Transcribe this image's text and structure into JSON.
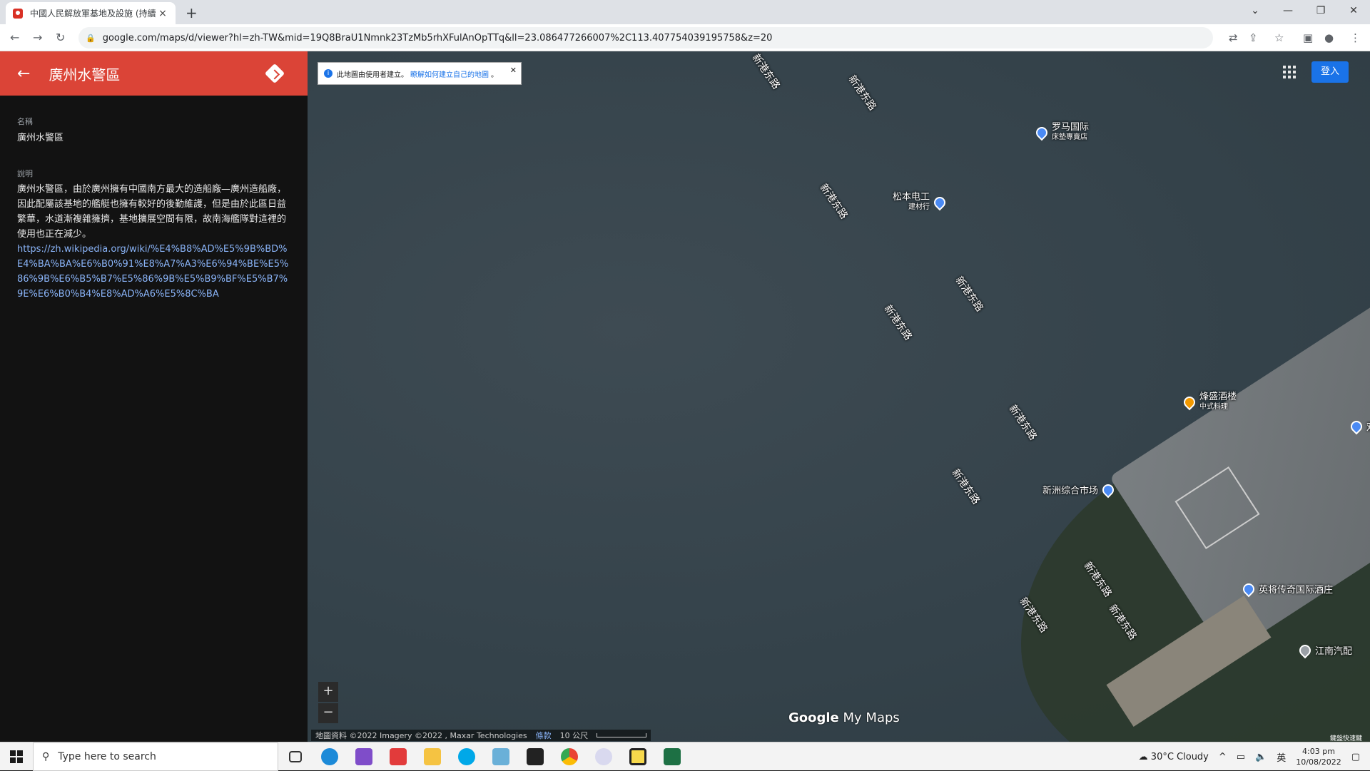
{
  "browser": {
    "tab_title": "中國人民解放軍基地及設施 (持續",
    "tab_close": "×",
    "new_tab": "+",
    "url": "google.com/maps/d/viewer?hl=zh-TW&mid=19Q8BraU1Nmnk23TzMb5rhXFulAnOpTTq&ll=23.086477266007%2C113.407754039195758&z=20"
  },
  "panel": {
    "title": "廣州水警區",
    "name_label": "名稱",
    "name_value": "廣州水警區",
    "desc_label": "說明",
    "description": "廣州水警區，由於廣州擁有中國南方最大的造船廠—廣州造船廠，因此配屬該基地的艦艇也擁有較好的後勤維護，但是由於此區日益繁華，水道漸複雜擁擠，基地擴展空間有限，故南海艦隊對這裡的使用也正在減少。",
    "link": "https://zh.wikipedia.org/wiki/%E4%B8%AD%E5%9B%BD%E4%BA%BA%E6%B0%91%E8%A7%A3%E6%94%BE%E5%86%9B%E6%B5%B7%E5%86%9B%E5%B9%BF%E5%B7%9E%E6%B0%B4%E8%AD%A6%E5%8C%BA"
  },
  "map": {
    "info_text": "此地圖由使用者建立。",
    "info_link": "瞭解如何建立自己的地圖",
    "info_tail": "。",
    "signin": "登入",
    "zoom_in": "+",
    "zoom_out": "−",
    "logo_google": "Google",
    "logo_mymaps": "My Maps",
    "attribution": "地圖資料 ©2022 Imagery ©2022 , Maxar Technologies",
    "terms": "條款",
    "scale": "10 公尺",
    "shortcut": "鍵盤快速鍵",
    "roads": [
      "新港东路",
      "新港东路",
      "新港东路",
      "新港东路",
      "新港东路",
      "新港东路",
      "新港东路",
      "新港东路",
      "新港东路",
      "新港东路"
    ],
    "pois": {
      "luoma": "罗马国际",
      "luoma_sub": "床墊專賣店",
      "songben": "松本电工",
      "songben_sub": "建材行",
      "fengsheng": "烽盛酒楼",
      "fengsheng_sub": "中式料理",
      "xinzhou": "新洲综合市场",
      "yingjiang": "英将传奇国际酒庄",
      "jiangnan": "江南汽配",
      "edge": "双"
    }
  },
  "taskbar": {
    "search_placeholder": "Type here to search",
    "weather": "30°C  Cloudy",
    "ime": "英",
    "time": "4:03 pm",
    "date": "10/08/2022"
  }
}
